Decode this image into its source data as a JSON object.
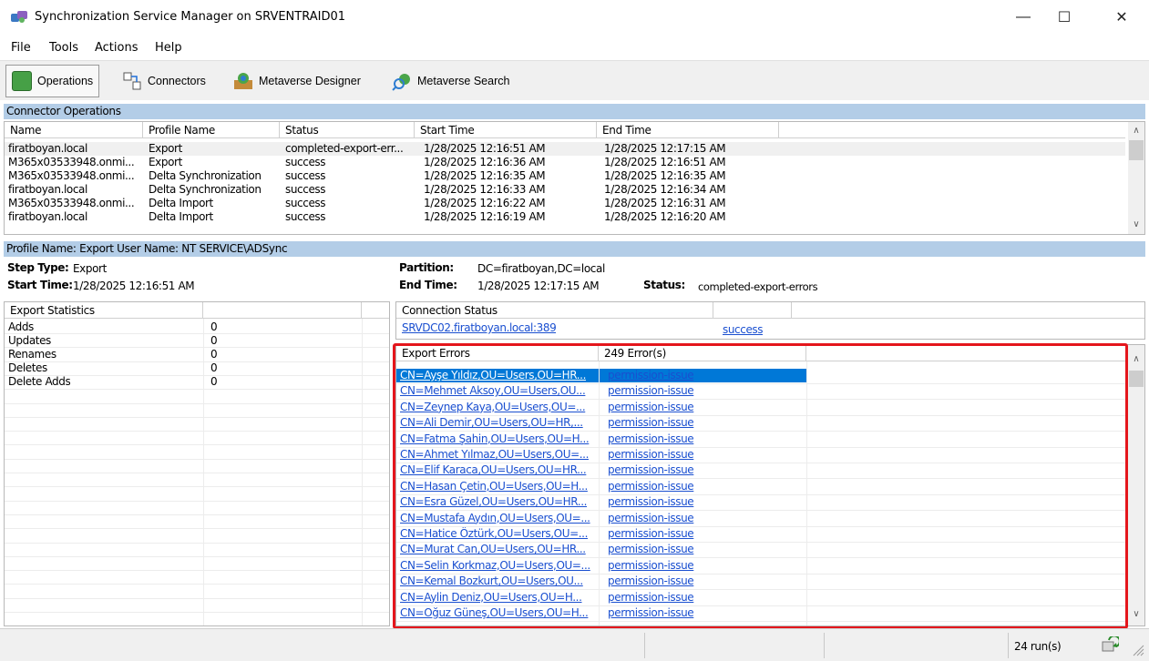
{
  "window": {
    "title": "Synchronization Service Manager on SRVENTRAID01",
    "minimize": "—",
    "maximize": "☐",
    "close": "✕"
  },
  "menu": [
    "File",
    "Tools",
    "Actions",
    "Help"
  ],
  "toolbar": {
    "operations": "Operations",
    "connectors": "Connectors",
    "metaverse_designer": "Metaverse Designer",
    "metaverse_search": "Metaverse Search"
  },
  "connector_operations": {
    "header": "Connector Operations",
    "columns": [
      "Name",
      "Profile Name",
      "Status",
      "Start Time",
      "End Time"
    ],
    "rows": [
      [
        "firatboyan.local",
        "Export",
        "completed-export-err...",
        "1/28/2025 12:16:51 AM",
        "1/28/2025 12:17:15 AM"
      ],
      [
        "M365x03533948.onmi...",
        "Export",
        "success",
        "1/28/2025 12:16:36 AM",
        "1/28/2025 12:16:51 AM"
      ],
      [
        "M365x03533948.onmi...",
        "Delta Synchronization",
        "success",
        "1/28/2025 12:16:35 AM",
        "1/28/2025 12:16:35 AM"
      ],
      [
        "firatboyan.local",
        "Delta Synchronization",
        "success",
        "1/28/2025 12:16:33 AM",
        "1/28/2025 12:16:34 AM"
      ],
      [
        "M365x03533948.onmi...",
        "Delta Import",
        "success",
        "1/28/2025 12:16:22 AM",
        "1/28/2025 12:16:31 AM"
      ],
      [
        "firatboyan.local",
        "Delta Import",
        "success",
        "1/28/2025 12:16:19 AM",
        "1/28/2025 12:16:20 AM"
      ]
    ]
  },
  "profile_bar": "Profile Name: Export  User Name: NT SERVICE\\ADSync",
  "details": {
    "step_type_label": "Step Type:",
    "step_type": "Export",
    "start_time_label": "Start Time:",
    "start_time": "1/28/2025 12:16:51 AM",
    "partition_label": "Partition:",
    "partition": "DC=firatboyan,DC=local",
    "end_time_label": "End Time:",
    "end_time": "1/28/2025 12:17:15 AM",
    "status_label": "Status:",
    "status": "completed-export-errors"
  },
  "export_statistics": {
    "header": "Export Statistics",
    "rows": [
      [
        "Adds",
        "0"
      ],
      [
        "Updates",
        "0"
      ],
      [
        "Renames",
        "0"
      ],
      [
        "Deletes",
        "0"
      ],
      [
        "Delete Adds",
        "0"
      ]
    ]
  },
  "connection_status": {
    "header": "Connection Status",
    "server": "SRVDC02.firatboyan.local:389",
    "result": "success"
  },
  "export_errors": {
    "header": "Export Errors",
    "count": "249 Error(s)",
    "rows": [
      [
        "CN=Ayşe Yıldız,OU=Users,OU=HR...",
        "permission-issue"
      ],
      [
        "CN=Mehmet Aksoy,OU=Users,OU...",
        "permission-issue"
      ],
      [
        "CN=Zeynep Kaya,OU=Users,OU=...",
        "permission-issue"
      ],
      [
        "CN=Ali Demir,OU=Users,OU=HR,...",
        "permission-issue"
      ],
      [
        "CN=Fatma Şahin,OU=Users,OU=H...",
        "permission-issue"
      ],
      [
        "CN=Ahmet Yılmaz,OU=Users,OU=...",
        "permission-issue"
      ],
      [
        "CN=Elif Karaca,OU=Users,OU=HR...",
        "permission-issue"
      ],
      [
        "CN=Hasan Çetin,OU=Users,OU=H...",
        "permission-issue"
      ],
      [
        "CN=Esra Güzel,OU=Users,OU=HR...",
        "permission-issue"
      ],
      [
        "CN=Mustafa Aydın,OU=Users,OU=...",
        "permission-issue"
      ],
      [
        "CN=Hatice Öztürk,OU=Users,OU=...",
        "permission-issue"
      ],
      [
        "CN=Murat Can,OU=Users,OU=HR...",
        "permission-issue"
      ],
      [
        "CN=Selin Korkmaz,OU=Users,OU=...",
        "permission-issue"
      ],
      [
        "CN=Kemal Bozkurt,OU=Users,OU...",
        "permission-issue"
      ],
      [
        "CN=Aylin Deniz,OU=Users,OU=H...",
        "permission-issue"
      ],
      [
        "CN=Oğuz Güneş,OU=Users,OU=H...",
        "permission-issue"
      ]
    ]
  },
  "statusbar": {
    "runs": "24 run(s)"
  },
  "colors": {
    "section_header": "#b3cde7",
    "selection": "#0078d7",
    "link": "#1a4fd0",
    "highlight_box": "#e4161c"
  }
}
